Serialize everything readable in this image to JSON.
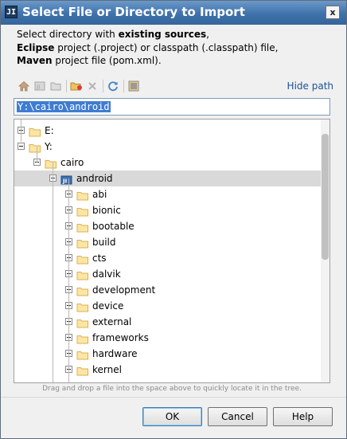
{
  "window": {
    "app_icon": "JI",
    "title": "Select File or Directory to Import",
    "close_glyph": "x"
  },
  "description": {
    "line1_pre": "Select directory with ",
    "line1_bold": "existing sources",
    "line1_post": ",",
    "line2_bold": "Eclipse",
    "line2_post": " project (.project) or classpath (.classpath) file,",
    "line3_bold": "Maven",
    "line3_post": " project file (pom.xml)."
  },
  "toolbar": {
    "hide_path_label": "Hide path",
    "icons": [
      "home-icon",
      "project-icon",
      "module-icon",
      "new-folder-icon",
      "delete-icon",
      "refresh-icon",
      "show-hidden-icon"
    ]
  },
  "path_field": {
    "value": "Y:\\cairo\\android"
  },
  "tree": {
    "items": [
      {
        "label": "E:",
        "expander": "plus"
      },
      {
        "label": "Y:",
        "expander": "minus"
      },
      {
        "label": "cairo",
        "expander": "minus"
      },
      {
        "label": "android",
        "expander": "minus",
        "selected": true
      },
      {
        "label": "abi",
        "expander": "plus"
      },
      {
        "label": "bionic",
        "expander": "plus"
      },
      {
        "label": "bootable",
        "expander": "plus"
      },
      {
        "label": "build",
        "expander": "plus"
      },
      {
        "label": "cts",
        "expander": "plus"
      },
      {
        "label": "dalvik",
        "expander": "plus"
      },
      {
        "label": "development",
        "expander": "plus"
      },
      {
        "label": "device",
        "expander": "plus"
      },
      {
        "label": "external",
        "expander": "plus"
      },
      {
        "label": "frameworks",
        "expander": "plus"
      },
      {
        "label": "hardware",
        "expander": "plus"
      },
      {
        "label": "kernel",
        "expander": "plus"
      }
    ]
  },
  "hint": "Drag and drop a file into the space above to quickly locate it in the tree.",
  "buttons": {
    "ok": "OK",
    "cancel": "Cancel",
    "help": "Help"
  },
  "colors": {
    "title_bar": "#3f72ab",
    "link": "#1c4f9c",
    "selection": "#3f7cd2",
    "folder": "#e0b044"
  }
}
